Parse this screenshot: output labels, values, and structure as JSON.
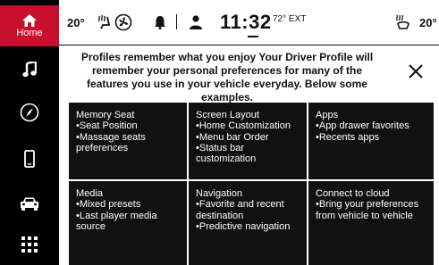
{
  "sidebar": {
    "items": [
      {
        "id": "home",
        "label": "Home",
        "icon": "home-icon"
      },
      {
        "id": "media",
        "icon": "music-note-icon"
      },
      {
        "id": "navigation",
        "icon": "compass-icon"
      },
      {
        "id": "phone",
        "icon": "phone-icon"
      },
      {
        "id": "vehicle",
        "icon": "car-icon"
      },
      {
        "id": "apps",
        "icon": "apps-grid-icon"
      }
    ],
    "active_color": "#c8102e"
  },
  "statusbar": {
    "temp_left": "20°",
    "clock": "11:32",
    "ext_temp": "72° EXT",
    "temp_right": "20°"
  },
  "main": {
    "intro": "Profiles remember what you enjoy Your Driver Profile will remember your personal preferences for many of the features you use in your vehicle everyday. Below some examples.",
    "cards": [
      {
        "title": "Memory Seat",
        "items": [
          "•Seat Position",
          "•Massage seats\n  preferences"
        ]
      },
      {
        "title": "Screen Layout",
        "items": [
          "•Home Customization",
          "•Menu bar Order",
          "•Status bar\n  customization"
        ]
      },
      {
        "title": "Apps",
        "items": [
          "•App drawer favorites",
          "•Recents apps"
        ]
      },
      {
        "title": "Media",
        "items": [
          "•Mixed presets",
          "•Last player media\n  source"
        ]
      },
      {
        "title": "Navigation",
        "items": [
          "•Favorite and recent\n  destination",
          "•Predictive navigation"
        ]
      },
      {
        "title": "Connect to cloud",
        "items": [
          "•Bring your preferences\n  from vehicle to vehicle"
        ]
      }
    ]
  }
}
